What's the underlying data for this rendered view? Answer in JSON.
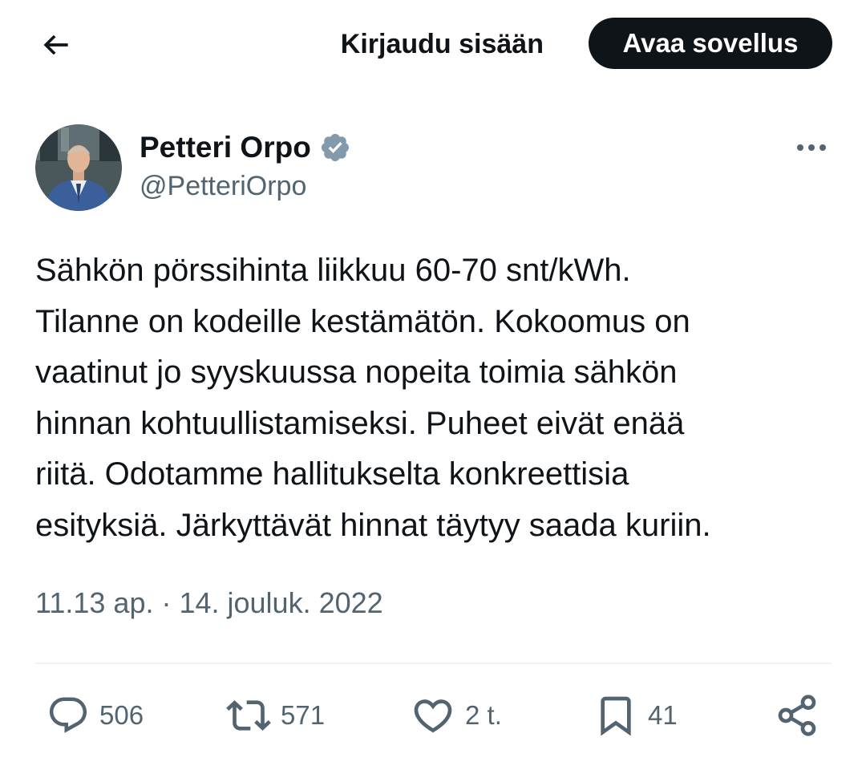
{
  "header": {
    "back_icon": "arrow-left-icon",
    "login_label": "Kirjaudu sisään",
    "open_app_label": "Avaa sovellus"
  },
  "author": {
    "display_name": "Petteri Orpo",
    "handle": "@PetteriOrpo",
    "verified_icon": "verified-badge-icon",
    "verified_color": "#829aab"
  },
  "tweet": {
    "lines": [
      "Sähkön pörssihinta liikkuu 60-70 snt/kWh.",
      "Tilanne on kodeille kestämätön. Kokoomus on",
      "vaatinut jo syyskuussa nopeita toimia sähkön",
      "hinnan kohtuullistamiseksi. Puheet eivät enää",
      "riitä. Odotamme hallitukselta konkreettisia",
      "esityksiä. Järkyttävät hinnat täytyy saada kuriin."
    ],
    "timestamp": "11.13 ap. · 14. jouluk. 2022"
  },
  "actions": {
    "replies": {
      "icon": "reply-icon",
      "count": "506"
    },
    "retweets": {
      "icon": "retweet-icon",
      "count": "571"
    },
    "likes": {
      "icon": "heart-icon",
      "count": "2 t."
    },
    "bookmarks": {
      "icon": "bookmark-icon",
      "count": "41"
    },
    "share": {
      "icon": "share-icon"
    }
  },
  "colors": {
    "text": "#0f1419",
    "secondary": "#536471",
    "button_bg": "#0f1419",
    "divider": "#eff3f4"
  }
}
